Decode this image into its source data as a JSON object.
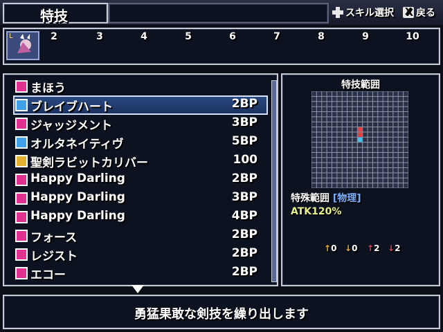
{
  "header": {
    "title": "特技",
    "hints": [
      {
        "icon": "dpad-icon",
        "label": "スキル選択"
      },
      {
        "icon": "x-button-icon",
        "label": "戻る",
        "glyph": "X"
      }
    ]
  },
  "level_strip": {
    "current_label": "L",
    "levels": [
      "2",
      "3",
      "4",
      "5",
      "6",
      "7",
      "8",
      "9",
      "10"
    ]
  },
  "skills": [
    {
      "name": "まほう",
      "cost": "",
      "icon_color": "#e03090"
    },
    {
      "name": "ブレイブハート",
      "cost": "2BP",
      "icon_color": "#40a0e8"
    },
    {
      "name": "ジャッジメント",
      "cost": "3BP",
      "icon_color": "#e03090"
    },
    {
      "name": "オルタネイティヴ",
      "cost": "5BP",
      "icon_color": "#40a0e8"
    },
    {
      "name": "聖剣ラビットカリバー",
      "cost": "100",
      "icon_color": "#e0b030"
    },
    {
      "name": "Happy Darling",
      "cost": "2BP",
      "icon_color": "#e03090"
    },
    {
      "name": "Happy Darling",
      "cost": "3BP",
      "icon_color": "#e03090"
    },
    {
      "name": "Happy Darling",
      "cost": "4BP",
      "icon_color": "#e03090"
    },
    {
      "name": "フォース",
      "cost": "2BP",
      "icon_color": "#e03090"
    },
    {
      "name": "レジスト",
      "cost": "2BP",
      "icon_color": "#e03090"
    },
    {
      "name": "エコー",
      "cost": "2BP",
      "icon_color": "#e03090"
    }
  ],
  "selected_index": 1,
  "range_panel": {
    "title": "特技範囲",
    "grid_size": 19,
    "markers": [
      {
        "col": 9,
        "row": 7,
        "color": "#e04040"
      },
      {
        "col": 9,
        "row": 8,
        "color": "#e04040"
      },
      {
        "col": 9,
        "row": 9,
        "color": "#40c0e8"
      }
    ],
    "modifiers": [
      "0",
      "0",
      "2",
      "2"
    ],
    "special_label": "特殊範囲",
    "attribute": "[物理]",
    "atk": "ATK120%"
  },
  "description": "勇猛果敢な剣技を繰り出します",
  "colors": {
    "accent_select": "#2a4a80",
    "atk_text": "#e8f08a",
    "attribute_text": "#7fb0ff"
  }
}
